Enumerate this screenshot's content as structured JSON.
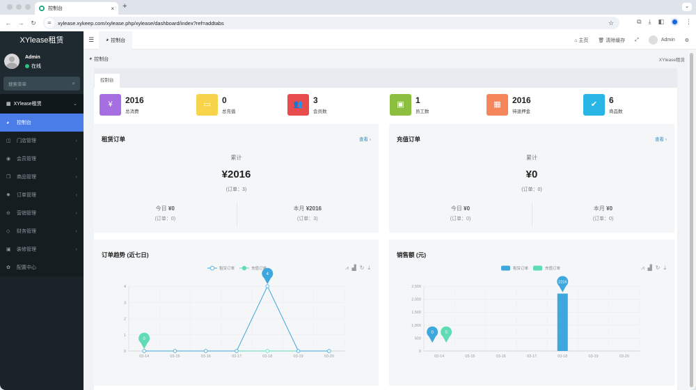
{
  "browser": {
    "tab_title": "控制台",
    "new_tab": "+",
    "close": "×",
    "url": "xylease.xykeep.com/xylease.php/xylease/dashboard/index?ref=addtabs"
  },
  "sidebar": {
    "logo": "XYlease租赁",
    "user": {
      "name": "Admin",
      "status": "在线"
    },
    "search_placeholder": "搜索菜单",
    "group": "XYlease租赁",
    "items": [
      {
        "label": "控制台",
        "icon": "dashboard-icon",
        "glyph": "◕",
        "active": true,
        "submenu": false
      },
      {
        "label": "门店管理",
        "icon": "store-icon",
        "glyph": "◫",
        "active": false,
        "submenu": true
      },
      {
        "label": "会员管理",
        "icon": "user-circle-icon",
        "glyph": "◉",
        "active": false,
        "submenu": true
      },
      {
        "label": "商品管理",
        "icon": "cubes-icon",
        "glyph": "❒",
        "active": false,
        "submenu": true
      },
      {
        "label": "订单管理",
        "icon": "order-icon",
        "glyph": "✹",
        "active": false,
        "submenu": true
      },
      {
        "label": "营销管理",
        "icon": "marketing-icon",
        "glyph": "⊖",
        "active": false,
        "submenu": true
      },
      {
        "label": "财务管理",
        "icon": "diamond-icon",
        "glyph": "◇",
        "active": false,
        "submenu": true
      },
      {
        "label": "装修管理",
        "icon": "picture-icon",
        "glyph": "▣",
        "active": false,
        "submenu": true
      },
      {
        "label": "配置中心",
        "icon": "gear-icon",
        "glyph": "✿",
        "active": false,
        "submenu": false
      }
    ]
  },
  "topbar": {
    "tab": "控制台",
    "home": "主页",
    "clear_cache": "清除缓存",
    "user": "Admin"
  },
  "breadcrumb": {
    "current": "控制台",
    "right": "XYlease租赁"
  },
  "panel_tab": "控制台",
  "stats": [
    {
      "value": "2016",
      "label": "总消费",
      "color": "#a66ee0",
      "glyph": "¥",
      "icon": "yen-icon"
    },
    {
      "value": "0",
      "label": "总充值",
      "color": "#f8d44c",
      "glyph": "▭",
      "icon": "archive-icon"
    },
    {
      "value": "3",
      "label": "会员数",
      "color": "#e84c4c",
      "glyph": "👥",
      "icon": "users-icon"
    },
    {
      "value": "1",
      "label": "员工数",
      "color": "#8cbf3f",
      "glyph": "▣",
      "icon": "badge-icon"
    },
    {
      "value": "2016",
      "label": "待退押金",
      "color": "#f5855b",
      "glyph": "▦",
      "icon": "grid-icon"
    },
    {
      "value": "6",
      "label": "商品数",
      "color": "#29b5e6",
      "glyph": "✔",
      "icon": "check-circle-icon"
    }
  ],
  "rent_orders": {
    "title": "租赁订单",
    "link": "查看 ›",
    "total_label": "累计",
    "total": "¥2016",
    "total_orders": "(订单：3)",
    "today_label": "今日",
    "today": "¥0",
    "today_orders": "(订单：0)",
    "month_label": "本月",
    "month": "¥2016",
    "month_orders": "(订单：3)"
  },
  "recharge_orders": {
    "title": "充值订单",
    "link": "查看 ›",
    "total_label": "累计",
    "total": "¥0",
    "total_orders": "(订单：0)",
    "today_label": "今日",
    "today": "¥0",
    "today_orders": "(订单：0)",
    "month_label": "本月",
    "month": "¥0",
    "month_orders": "(订单：0)"
  },
  "chart_data": [
    {
      "type": "line",
      "title": "订单趋势 (近七日)",
      "categories": [
        "03-14",
        "03-15",
        "03-16",
        "03-17",
        "03-18",
        "03-19",
        "03-20"
      ],
      "series": [
        {
          "name": "租赁订单",
          "color": "#3ea7dd",
          "values": [
            0,
            0,
            0,
            0,
            4,
            0,
            0
          ],
          "markpoint": {
            "index": 4,
            "label": "4"
          }
        },
        {
          "name": "充值订单",
          "color": "#5fdcb3",
          "values": [
            0,
            0,
            0,
            0,
            0,
            0,
            0
          ],
          "markpoint": {
            "index": 0,
            "label": "0"
          }
        }
      ],
      "ylim": [
        0,
        4
      ],
      "yticks": [
        0,
        1,
        2,
        3,
        4
      ],
      "grid": true,
      "legend": "top-center"
    },
    {
      "type": "bar",
      "title": "销售额 (元)",
      "categories": [
        "03-14",
        "03-15",
        "03-16",
        "03-17",
        "03-18",
        "03-19",
        "03-20"
      ],
      "series": [
        {
          "name": "租赁订单",
          "color": "#3ea7dd",
          "values": [
            0,
            0,
            0,
            0,
            2216,
            0,
            0
          ],
          "markpoints": [
            {
              "index": 4,
              "label": "2216"
            },
            {
              "index": 0,
              "label": "0"
            }
          ]
        },
        {
          "name": "充值订单",
          "color": "#5fdcb3",
          "values": [
            0,
            0,
            0,
            0,
            0,
            0,
            0
          ],
          "markpoints": [
            {
              "index": 0,
              "label": "0"
            }
          ]
        }
      ],
      "ylim": [
        0,
        2500
      ],
      "yticks": [
        "0",
        "500",
        "1,000",
        "1,500",
        "2,000",
        "2,500"
      ],
      "grid": true,
      "legend": "top-center"
    }
  ],
  "chart_tools": [
    "line-chart-icon",
    "bar-chart-icon",
    "refresh-icon",
    "download-icon"
  ]
}
